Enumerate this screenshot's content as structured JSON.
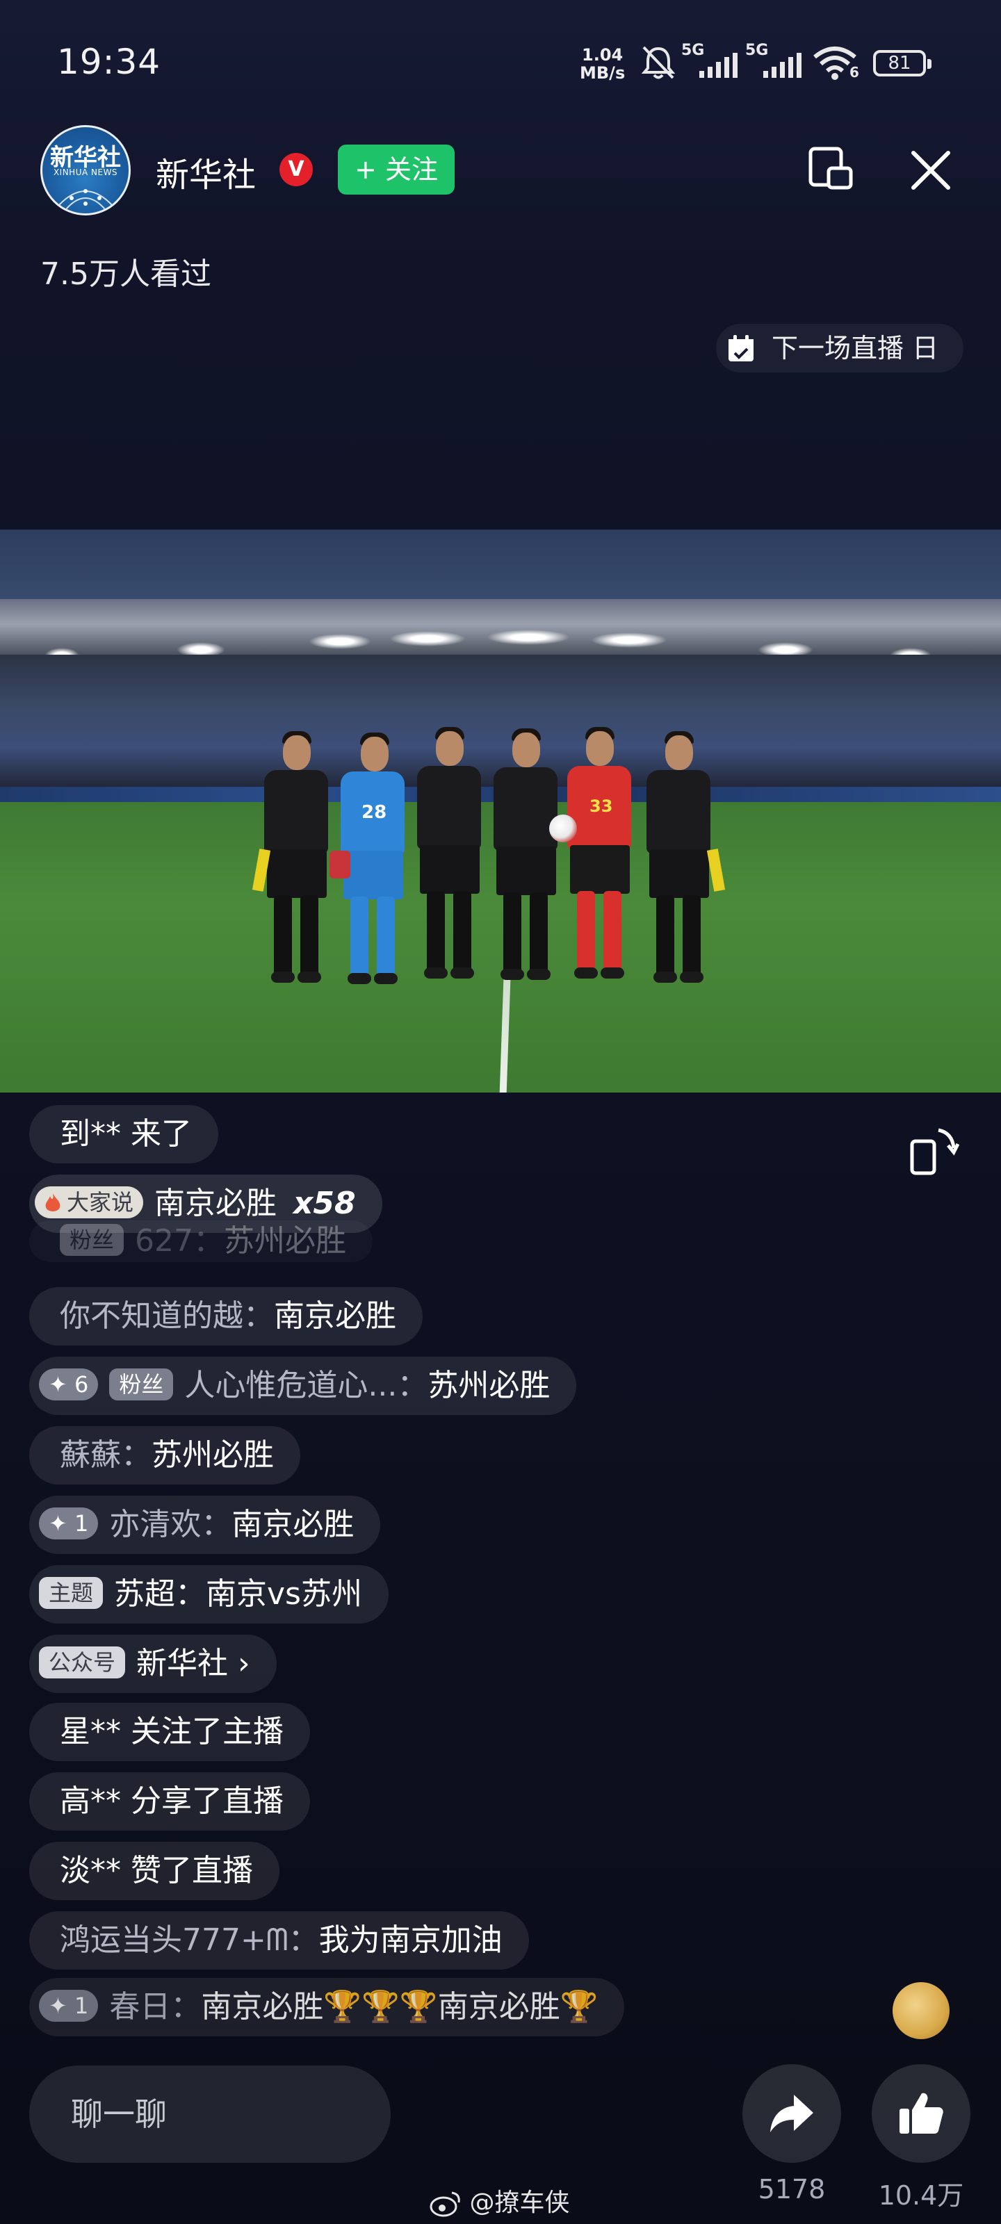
{
  "status_bar": {
    "time": "19:34",
    "net_speed_value": "1.04",
    "net_speed_unit": "MB/s",
    "signal_1": "5G",
    "signal_2": "5G",
    "wifi_label": "6",
    "battery": "81"
  },
  "header": {
    "avatar_text_cn": "新华社",
    "avatar_text_en": "XINHUA NEWS",
    "account_name": "新华社",
    "verified_badge": "V",
    "follow_label": "+ 关注",
    "viewers": "7.5万人看过",
    "next_live": "下一场直播 日"
  },
  "chat": {
    "items": [
      {
        "user": "到**",
        "text": " 来了"
      },
      {
        "chip": "大家说",
        "text": "南京必胜",
        "multiplier": "x58"
      },
      {
        "chip": "粉丝",
        "user": "627：",
        "text": "苏州必胜"
      },
      {
        "user": "你不知道的越：",
        "text": "南京必胜"
      },
      {
        "chip": "✦ 6",
        "chip2": "粉丝",
        "user": "人心惟危道心...：",
        "text": "苏州必胜"
      },
      {
        "user": "蘇蘇：",
        "text": "苏州必胜"
      },
      {
        "chip": "✦ 1",
        "user": "亦清欢：",
        "text": "南京必胜"
      },
      {
        "chip": "主题",
        "text": "苏超：南京vs苏州"
      },
      {
        "chip": "公众号",
        "text": "新华社 ›"
      },
      {
        "user": "星**",
        "text": " 关注了主播"
      },
      {
        "user": "高**",
        "text": " 分享了直播"
      },
      {
        "user": "淡**",
        "text": " 赞了直播"
      },
      {
        "user": "鸿运当头777+ᗰ：",
        "text": "我为南京加油"
      },
      {
        "chip": "✦ 1",
        "user": "春日：",
        "text": "南京必胜🏆🏆🏆南京必胜🏆"
      }
    ]
  },
  "bottom": {
    "input_placeholder": "聊一聊",
    "share_count": "5178",
    "like_count": "10.4万",
    "watermark": "@撩车侠"
  },
  "video": {
    "player_numbers": [
      "28",
      "33"
    ]
  }
}
